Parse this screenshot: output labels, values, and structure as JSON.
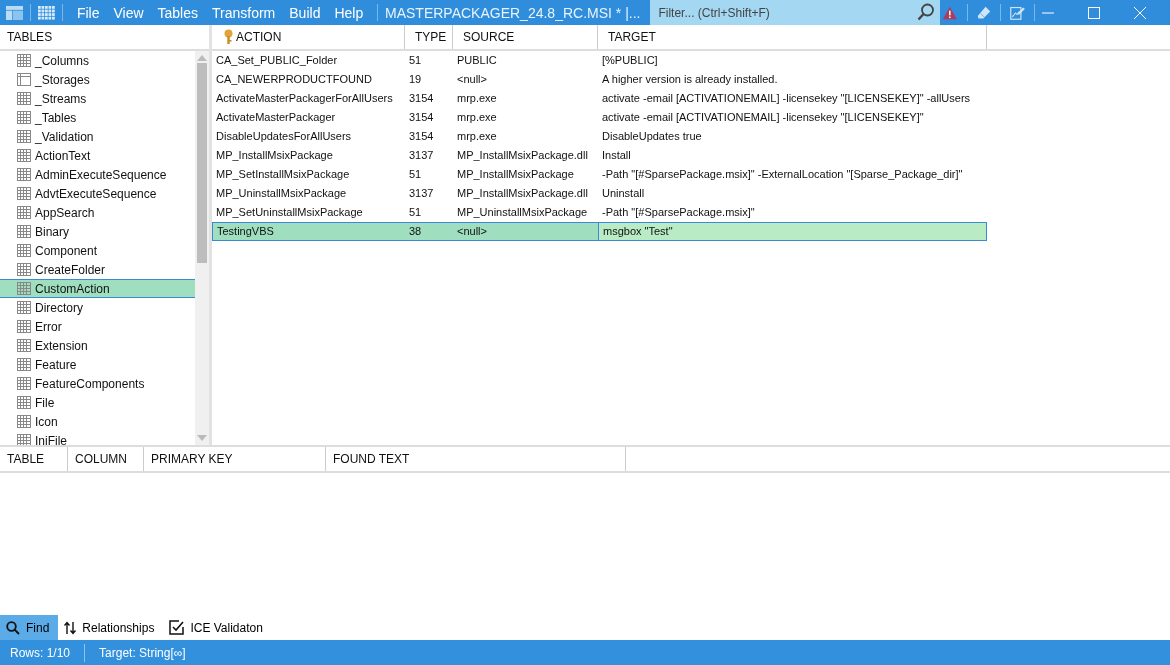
{
  "menu": [
    "File",
    "View",
    "Tables",
    "Transform",
    "Build",
    "Help"
  ],
  "window": {
    "title": "MASTERPACKAGER_24.8_RC.MSI * |..."
  },
  "filter": {
    "placeholder": "Filter... (Ctrl+Shift+F)"
  },
  "sidebar": {
    "heading": "TABLES",
    "items": [
      {
        "label": "_Columns",
        "kind": "table",
        "selected": false
      },
      {
        "label": "_Storages",
        "kind": "storage",
        "selected": false
      },
      {
        "label": "_Streams",
        "kind": "table",
        "selected": false
      },
      {
        "label": "_Tables",
        "kind": "table",
        "selected": false
      },
      {
        "label": "_Validation",
        "kind": "table",
        "selected": false
      },
      {
        "label": "ActionText",
        "kind": "table",
        "selected": false
      },
      {
        "label": "AdminExecuteSequence",
        "kind": "table",
        "selected": false
      },
      {
        "label": "AdvtExecuteSequence",
        "kind": "table",
        "selected": false
      },
      {
        "label": "AppSearch",
        "kind": "table",
        "selected": false
      },
      {
        "label": "Binary",
        "kind": "table",
        "selected": false
      },
      {
        "label": "Component",
        "kind": "table",
        "selected": false
      },
      {
        "label": "CreateFolder",
        "kind": "table",
        "selected": false
      },
      {
        "label": "CustomAction",
        "kind": "table",
        "selected": true
      },
      {
        "label": "Directory",
        "kind": "table",
        "selected": false
      },
      {
        "label": "Error",
        "kind": "table",
        "selected": false
      },
      {
        "label": "Extension",
        "kind": "table",
        "selected": false
      },
      {
        "label": "Feature",
        "kind": "table",
        "selected": false
      },
      {
        "label": "FeatureComponents",
        "kind": "table",
        "selected": false
      },
      {
        "label": "File",
        "kind": "table",
        "selected": false
      },
      {
        "label": "Icon",
        "kind": "table",
        "selected": false
      },
      {
        "label": "IniFile",
        "kind": "table",
        "selected": false
      }
    ]
  },
  "table": {
    "columns": [
      {
        "label": "ACTION",
        "primary_key": true
      },
      {
        "label": "TYPE",
        "primary_key": false
      },
      {
        "label": "SOURCE",
        "primary_key": false
      },
      {
        "label": "TARGET",
        "primary_key": false
      }
    ],
    "rows": [
      {
        "cells": [
          "CA_Set_PUBLIC_Folder",
          "51",
          "PUBLIC",
          "[%PUBLIC]"
        ],
        "selected": false
      },
      {
        "cells": [
          "CA_NEWERPRODUCTFOUND",
          "19",
          "<null>",
          "A higher version is already installed."
        ],
        "selected": false
      },
      {
        "cells": [
          "ActivateMasterPackagerForAllUsers",
          "3154",
          "mrp.exe",
          "activate -email [ACTIVATIONEMAIL] -licensekey \"[LICENSEKEY]\" -allUsers"
        ],
        "selected": false
      },
      {
        "cells": [
          "ActivateMasterPackager",
          "3154",
          "mrp.exe",
          "activate -email [ACTIVATIONEMAIL] -licensekey \"[LICENSEKEY]\""
        ],
        "selected": false
      },
      {
        "cells": [
          "DisableUpdatesForAllUsers",
          "3154",
          "mrp.exe",
          "DisableUpdates true"
        ],
        "selected": false
      },
      {
        "cells": [
          "MP_InstallMsixPackage",
          "3137",
          "MP_InstallMsixPackage.dll",
          "Install"
        ],
        "selected": false
      },
      {
        "cells": [
          "MP_SetInstallMsixPackage",
          "51",
          "MP_InstallMsixPackage",
          "-Path \"[#SparsePackage.msix]\" -ExternalLocation \"[Sparse_Package_dir]\""
        ],
        "selected": false
      },
      {
        "cells": [
          "MP_UninstallMsixPackage",
          "3137",
          "MP_InstallMsixPackage.dll",
          "Uninstall"
        ],
        "selected": false
      },
      {
        "cells": [
          "MP_SetUninstallMsixPackage",
          "51",
          "MP_UninstallMsixPackage",
          "-Path \"[#SparsePackage.msix]\""
        ],
        "selected": false
      },
      {
        "cells": [
          "TestingVBS",
          "38",
          "<null>",
          "msgbox \"Test\""
        ],
        "selected": true
      }
    ]
  },
  "find_results": {
    "columns": [
      "TABLE",
      "COLUMN",
      "PRIMARY KEY",
      "FOUND TEXT"
    ]
  },
  "bottom_tabs": [
    {
      "label": "Find",
      "kind": "find",
      "selected": true
    },
    {
      "label": "Relationships",
      "kind": "relationships",
      "selected": false
    },
    {
      "label": "ICE Validaton",
      "kind": "ice",
      "selected": false
    }
  ],
  "status_bar": [
    "Rows: 1/10",
    "Target: String[∞]"
  ]
}
